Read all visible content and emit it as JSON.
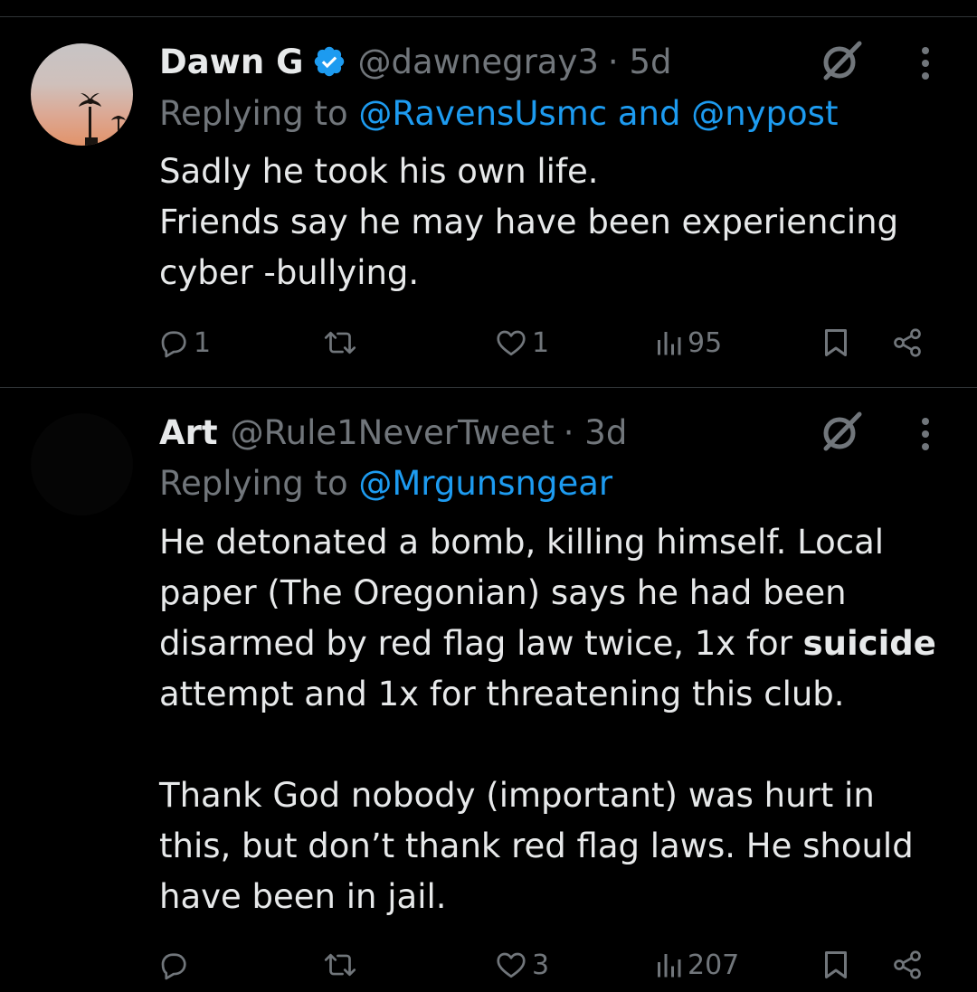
{
  "tweets": [
    {
      "name": "Dawn G",
      "handle": "@dawnegray3",
      "time": "· 5d",
      "replying_prefix": "Replying to",
      "replying_mentions": "@RavensUsmc and @nypost",
      "body_lines": [
        "Sadly he took his own life.",
        "Friends say he may have been experiencing",
        "cyber -bullying."
      ],
      "actions": {
        "reply_count": "1",
        "retweet_count": "",
        "like_count": "1",
        "views_count": "95"
      }
    },
    {
      "name": "Art",
      "handle": "@Rule1NeverTweet",
      "time": "· 3d",
      "replying_prefix": "Replying to",
      "replying_mentions": "@Mrgunsngear",
      "body_lines": [
        "He detonated a bomb, killing himself. Local",
        "paper (The Oregonian) says he had been",
        "disarmed by red flag law twice, 1x for ",
        "suicide",
        "attempt and 1x for threatening this club.",
        "Thank God nobody (important) was hurt in",
        "this, but don’t thank red flag laws. He should",
        "have been in jail."
      ],
      "actions": {
        "reply_count": "",
        "retweet_count": "",
        "like_count": "3",
        "views_count": "207"
      }
    }
  ],
  "icons": {
    "verified": "verified-badge-icon",
    "grok": "grok-icon",
    "more": "more-vertical-icon",
    "reply": "reply-icon",
    "retweet": "retweet-icon",
    "like": "heart-icon",
    "views": "views-bar-chart-icon",
    "bookmark": "bookmark-icon",
    "share": "share-icon"
  },
  "colors": {
    "background": "#000000",
    "text_primary": "#e7e9ea",
    "text_secondary": "#71767b",
    "accent": "#1d9bf0",
    "divider": "#2f3336"
  }
}
